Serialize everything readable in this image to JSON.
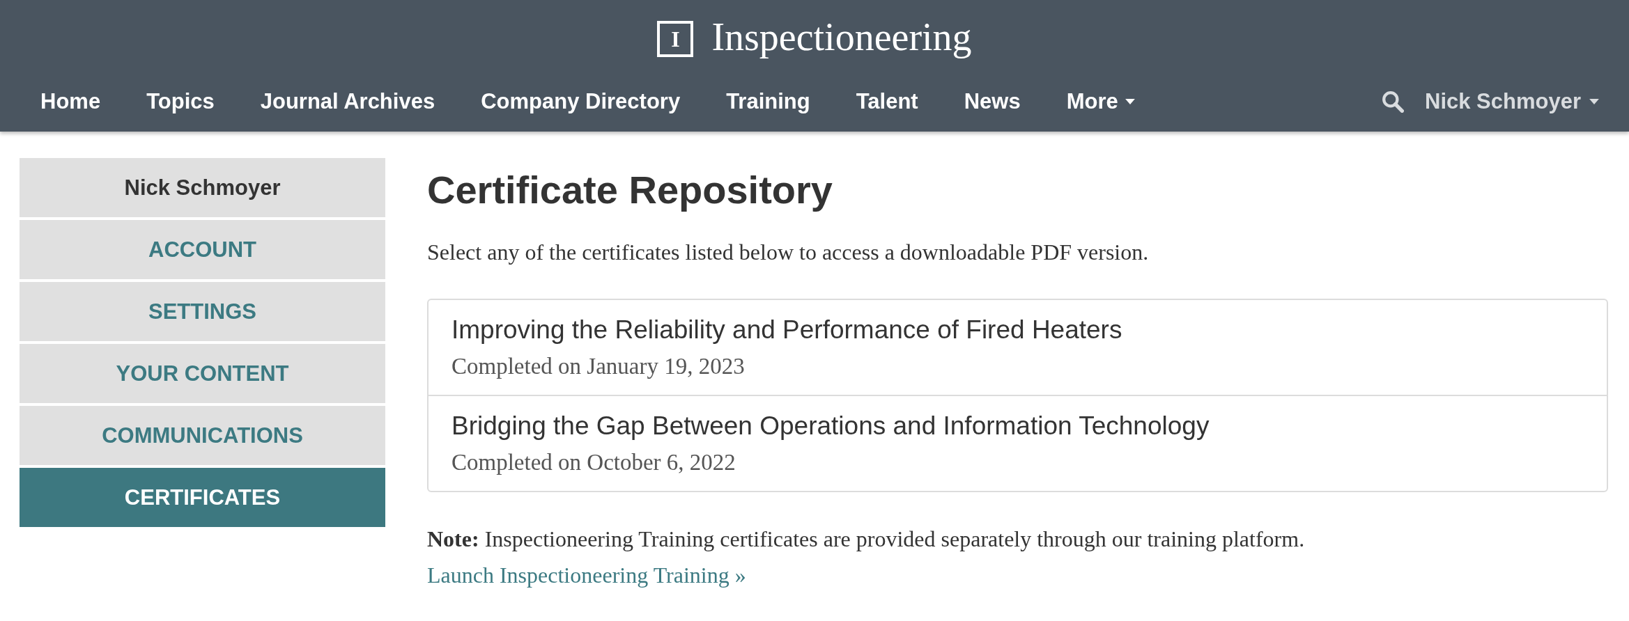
{
  "header": {
    "logo_mark": "I",
    "logo_text": "Inspectioneering"
  },
  "nav": {
    "items": [
      {
        "label": "Home",
        "dropdown": false
      },
      {
        "label": "Topics",
        "dropdown": false
      },
      {
        "label": "Journal Archives",
        "dropdown": false
      },
      {
        "label": "Company Directory",
        "dropdown": false
      },
      {
        "label": "Training",
        "dropdown": false
      },
      {
        "label": "Talent",
        "dropdown": false
      },
      {
        "label": "News",
        "dropdown": false
      },
      {
        "label": "More",
        "dropdown": true
      }
    ],
    "user": {
      "label": "Nick Schmoyer",
      "dropdown": true
    }
  },
  "sidebar": {
    "items": [
      {
        "label": "Nick Schmoyer",
        "kind": "name",
        "selected": false
      },
      {
        "label": "ACCOUNT",
        "kind": "link",
        "selected": false
      },
      {
        "label": "SETTINGS",
        "kind": "link",
        "selected": false
      },
      {
        "label": "YOUR CONTENT",
        "kind": "link",
        "selected": false
      },
      {
        "label": "COMMUNICATIONS",
        "kind": "link",
        "selected": false
      },
      {
        "label": "CERTIFICATES",
        "kind": "link",
        "selected": true
      }
    ]
  },
  "main": {
    "title": "Certificate Repository",
    "intro": "Select any of the certificates listed below to access a downloadable PDF version.",
    "certificates": [
      {
        "title": "Improving the Reliability and Performance of Fired Heaters",
        "completed": "Completed on January 19, 2023"
      },
      {
        "title": "Bridging the Gap Between Operations and Information Technology",
        "completed": "Completed on October 6, 2022"
      }
    ],
    "note": {
      "text": "**Note:** Inspectioneering Training certificates are provided separately through our training platform.",
      "link": "Launch Inspectioneering Training »"
    }
  }
}
